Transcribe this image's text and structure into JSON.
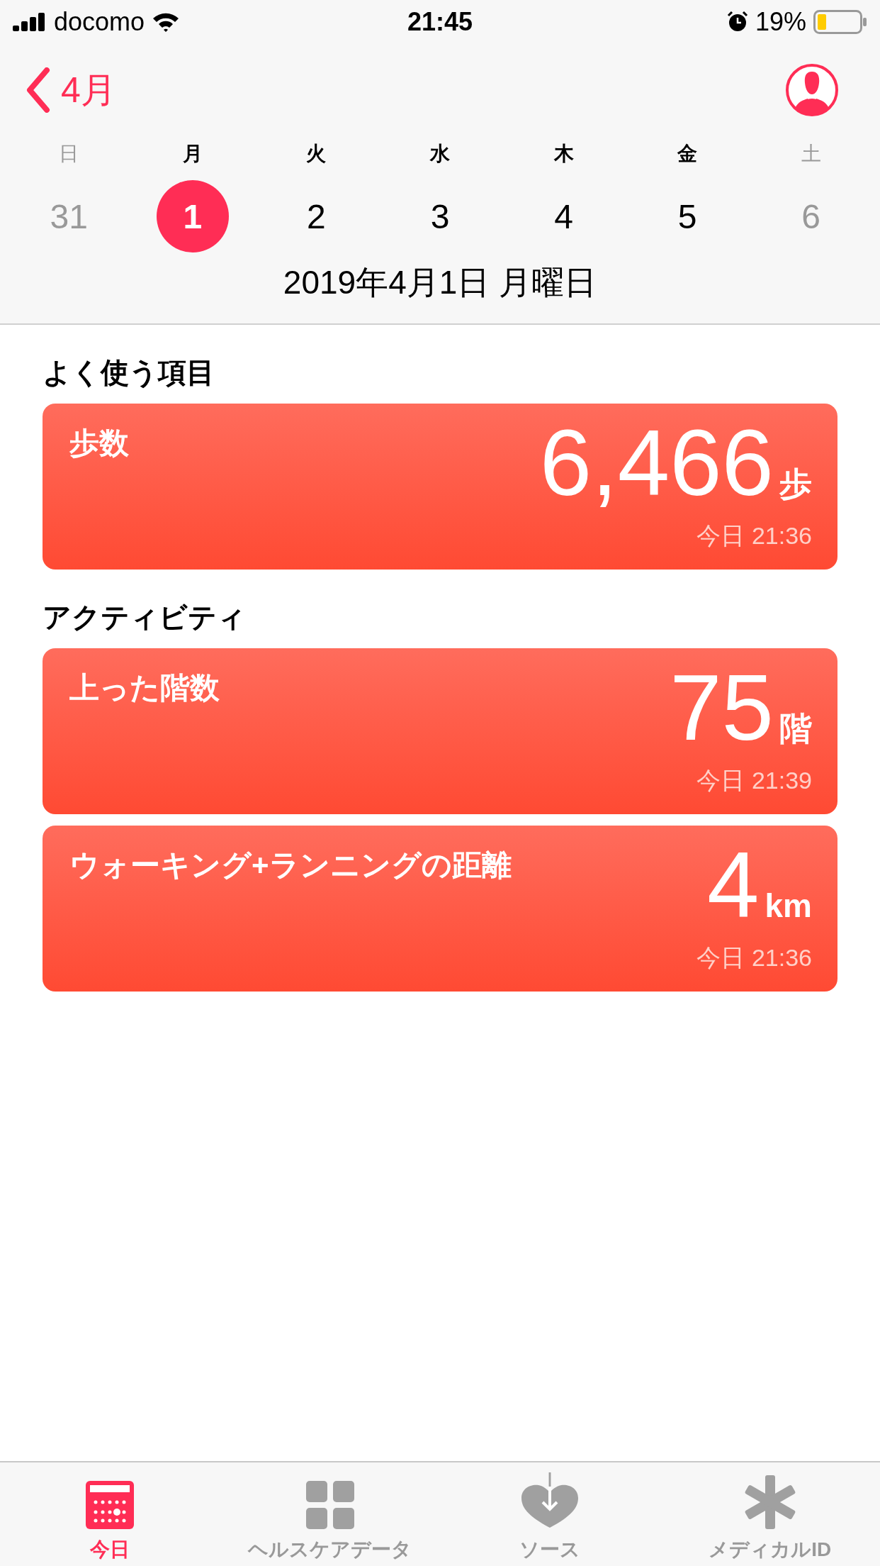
{
  "status_bar": {
    "carrier": "docomo",
    "time": "21:45",
    "battery": "19%"
  },
  "nav": {
    "back": "4月"
  },
  "week": [
    {
      "weekday": "日",
      "day": "31",
      "dimmed": true,
      "selected": false
    },
    {
      "weekday": "月",
      "day": "1",
      "dimmed": false,
      "selected": true
    },
    {
      "weekday": "火",
      "day": "2",
      "dimmed": false,
      "selected": false
    },
    {
      "weekday": "水",
      "day": "3",
      "dimmed": false,
      "selected": false
    },
    {
      "weekday": "木",
      "day": "4",
      "dimmed": false,
      "selected": false
    },
    {
      "weekday": "金",
      "day": "5",
      "dimmed": false,
      "selected": false
    },
    {
      "weekday": "土",
      "day": "6",
      "dimmed": true,
      "selected": false
    }
  ],
  "date_label": "2019年4月1日 月曜日",
  "sections": [
    {
      "title": "よく使う項目",
      "cards": [
        {
          "title": "歩数",
          "value": "6,466",
          "unit": "歩",
          "time": "今日 21:36"
        }
      ]
    },
    {
      "title": "アクティビティ",
      "cards": [
        {
          "title": "上った階数",
          "value": "75",
          "unit": "階",
          "time": "今日 21:39"
        },
        {
          "title": "ウォーキング+ランニングの距離",
          "value": "4",
          "unit": "km",
          "time": "今日 21:36"
        }
      ]
    }
  ],
  "tabs": [
    {
      "label": "今日",
      "kind": "today",
      "selected": true
    },
    {
      "label": "ヘルスケアデータ",
      "kind": "data",
      "selected": false
    },
    {
      "label": "ソース",
      "kind": "sources",
      "selected": false
    },
    {
      "label": "メディカルID",
      "kind": "medical",
      "selected": false
    }
  ]
}
